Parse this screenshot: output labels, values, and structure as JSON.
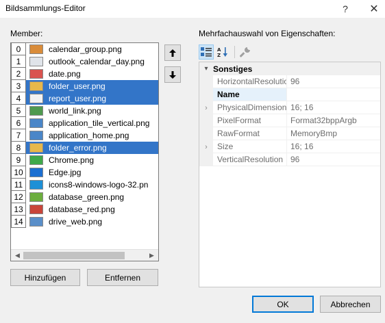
{
  "window": {
    "title": "Bildsammlungs-Editor",
    "help_label": "?",
    "close_label": "✕"
  },
  "members": {
    "label": "Member:",
    "items": [
      {
        "index": "0",
        "name": "calendar_group.png",
        "selected": false,
        "thumb_color": "#d98c3a"
      },
      {
        "index": "1",
        "name": "outlook_calendar_day.png",
        "selected": false,
        "thumb_color": "#e0e4ea"
      },
      {
        "index": "2",
        "name": "date.png",
        "selected": false,
        "thumb_color": "#d9534f"
      },
      {
        "index": "3",
        "name": "folder_user.png",
        "selected": true,
        "thumb_color": "#e8b84a"
      },
      {
        "index": "4",
        "name": "report_user.png",
        "selected": true,
        "thumb_color": "#f2f2f2"
      },
      {
        "index": "5",
        "name": "world_link.png",
        "selected": false,
        "thumb_color": "#4f9a4f"
      },
      {
        "index": "6",
        "name": "application_tile_vertical.png",
        "selected": false,
        "thumb_color": "#4a86c8"
      },
      {
        "index": "7",
        "name": "application_home.png",
        "selected": false,
        "thumb_color": "#4a86c8"
      },
      {
        "index": "8",
        "name": "folder_error.png",
        "selected": true,
        "thumb_color": "#e8b84a"
      },
      {
        "index": "9",
        "name": "Chrome.png",
        "selected": false,
        "thumb_color": "#3fa94a"
      },
      {
        "index": "10",
        "name": "Edge.jpg",
        "selected": false,
        "thumb_color": "#1c6fd1"
      },
      {
        "index": "11",
        "name": "icons8-windows-logo-32.pn",
        "selected": false,
        "thumb_color": "#1e90d6"
      },
      {
        "index": "12",
        "name": "database_green.png",
        "selected": false,
        "thumb_color": "#6cae3e"
      },
      {
        "index": "13",
        "name": "database_red.png",
        "selected": false,
        "thumb_color": "#c9453a"
      },
      {
        "index": "14",
        "name": "drive_web.png",
        "selected": false,
        "thumb_color": "#5a8fc9"
      }
    ]
  },
  "move_buttons": {
    "up_icon": "arrow-up-icon",
    "down_icon": "arrow-down-icon"
  },
  "list_buttons": {
    "add_label": "Hinzufügen",
    "remove_label": "Entfernen"
  },
  "properties": {
    "label": "Mehrfachauswahl von Eigenschaften:",
    "toolbar": [
      "categorized-icon",
      "alphabetical-icon",
      "property-pages-icon"
    ],
    "category": "Sonstiges",
    "category_expander": "▾",
    "rows": [
      {
        "name": "HorizontalResolution",
        "value": "96",
        "expandable": false,
        "selected": false
      },
      {
        "name": "Name",
        "value": "",
        "expandable": false,
        "selected": true
      },
      {
        "name": "PhysicalDimension",
        "value": "16; 16",
        "expandable": true,
        "selected": false
      },
      {
        "name": "PixelFormat",
        "value": "Format32bppArgb",
        "expandable": false,
        "selected": false
      },
      {
        "name": "RawFormat",
        "value": "MemoryBmp",
        "expandable": false,
        "selected": false
      },
      {
        "name": "Size",
        "value": "16; 16",
        "expandable": true,
        "selected": false
      },
      {
        "name": "VerticalResolution",
        "value": "96",
        "expandable": false,
        "selected": false
      }
    ]
  },
  "dialog_buttons": {
    "ok_label": "OK",
    "cancel_label": "Abbrechen"
  },
  "colors": {
    "selection": "#3375c8",
    "accent": "#0078d7"
  }
}
